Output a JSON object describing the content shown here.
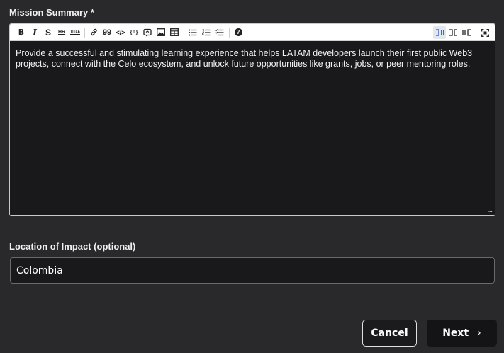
{
  "summary": {
    "label": "Mission Summary *",
    "text": "Provide a successful and stimulating learning experience that helps LATAM developers launch their first public Web3 projects, connect with the Celo ecosystem, and unlock future opportunities like grants, jobs, or peer mentoring roles.",
    "resize_glyph": "..."
  },
  "toolbar": {
    "bold": "B",
    "italic": "I",
    "strike": "S",
    "hr": "HR",
    "title": "TITLE",
    "quote": "99",
    "code": "</>",
    "var": "{=}",
    "help": "?",
    "icons": [
      "bold-icon",
      "italic-icon",
      "strikethrough-icon",
      "horizontal-rule-icon",
      "title-icon",
      "link-icon",
      "quote-icon",
      "code-icon",
      "code-block-icon",
      "comment-icon",
      "image-icon",
      "table-icon",
      "unordered-list-icon",
      "ordered-list-icon",
      "checklist-icon",
      "help-icon",
      "edit-mode-icon",
      "live-mode-icon",
      "preview-mode-icon",
      "fullscreen-icon"
    ]
  },
  "location": {
    "label": "Location of Impact (optional)",
    "value": "Colombia"
  },
  "actions": {
    "cancel_label": "Cancel",
    "next_label": "Next",
    "next_glyph": "›"
  }
}
